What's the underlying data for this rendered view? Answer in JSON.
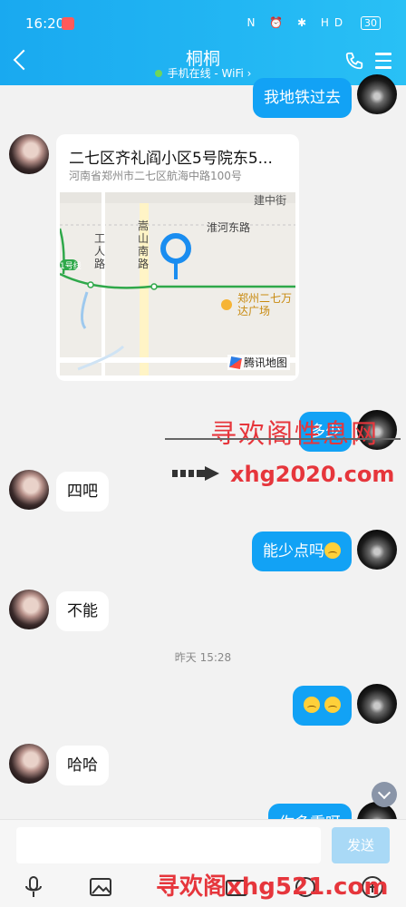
{
  "status_bar": {
    "time": "16:20",
    "indicators": "N ⏰ ✱ HD",
    "battery": "30"
  },
  "header": {
    "title": "桐桐",
    "subtitle": "手机在线 - WiFi ›",
    "accent_color": "#1aa9f0",
    "icons": [
      "back-icon",
      "phone-icon",
      "menu-icon"
    ]
  },
  "messages": [
    {
      "side": "right",
      "text": "我地铁过去"
    },
    {
      "side": "left",
      "type": "location",
      "title": "二七区齐礼阎小区5号院东5...",
      "address": "河南省郑州市二七区航海中路100号"
    },
    {
      "side": "right",
      "text": "多少"
    },
    {
      "side": "left",
      "text": "四吧"
    },
    {
      "side": "right",
      "text": "能少点吗"
    },
    {
      "side": "left",
      "text": "不能"
    },
    {
      "side": "right",
      "text": ""
    },
    {
      "side": "left",
      "text": "哈哈"
    },
    {
      "side": "right",
      "text": "你多重呀"
    }
  ],
  "map": {
    "labels": {
      "road_1": "建中街",
      "road_2": "淮河东路",
      "road_3": "工人路",
      "road_4": "嵩山南路",
      "metro": "1号线",
      "poi": "郑州二七万达广场",
      "logo": "腾讯地图"
    }
  },
  "time_separator": "昨天 15:28",
  "watermarks": {
    "wm1": "寻欢阁性息网",
    "wm2": "xhg2020.com",
    "wm3": "寻欢阁xhg521.com"
  },
  "composer": {
    "placeholder": "",
    "send_label": "发送"
  },
  "toolbar_icons": [
    "mic-icon",
    "image-icon",
    "camera-icon",
    "redpacket-icon",
    "emoji-icon",
    "plus-icon"
  ]
}
